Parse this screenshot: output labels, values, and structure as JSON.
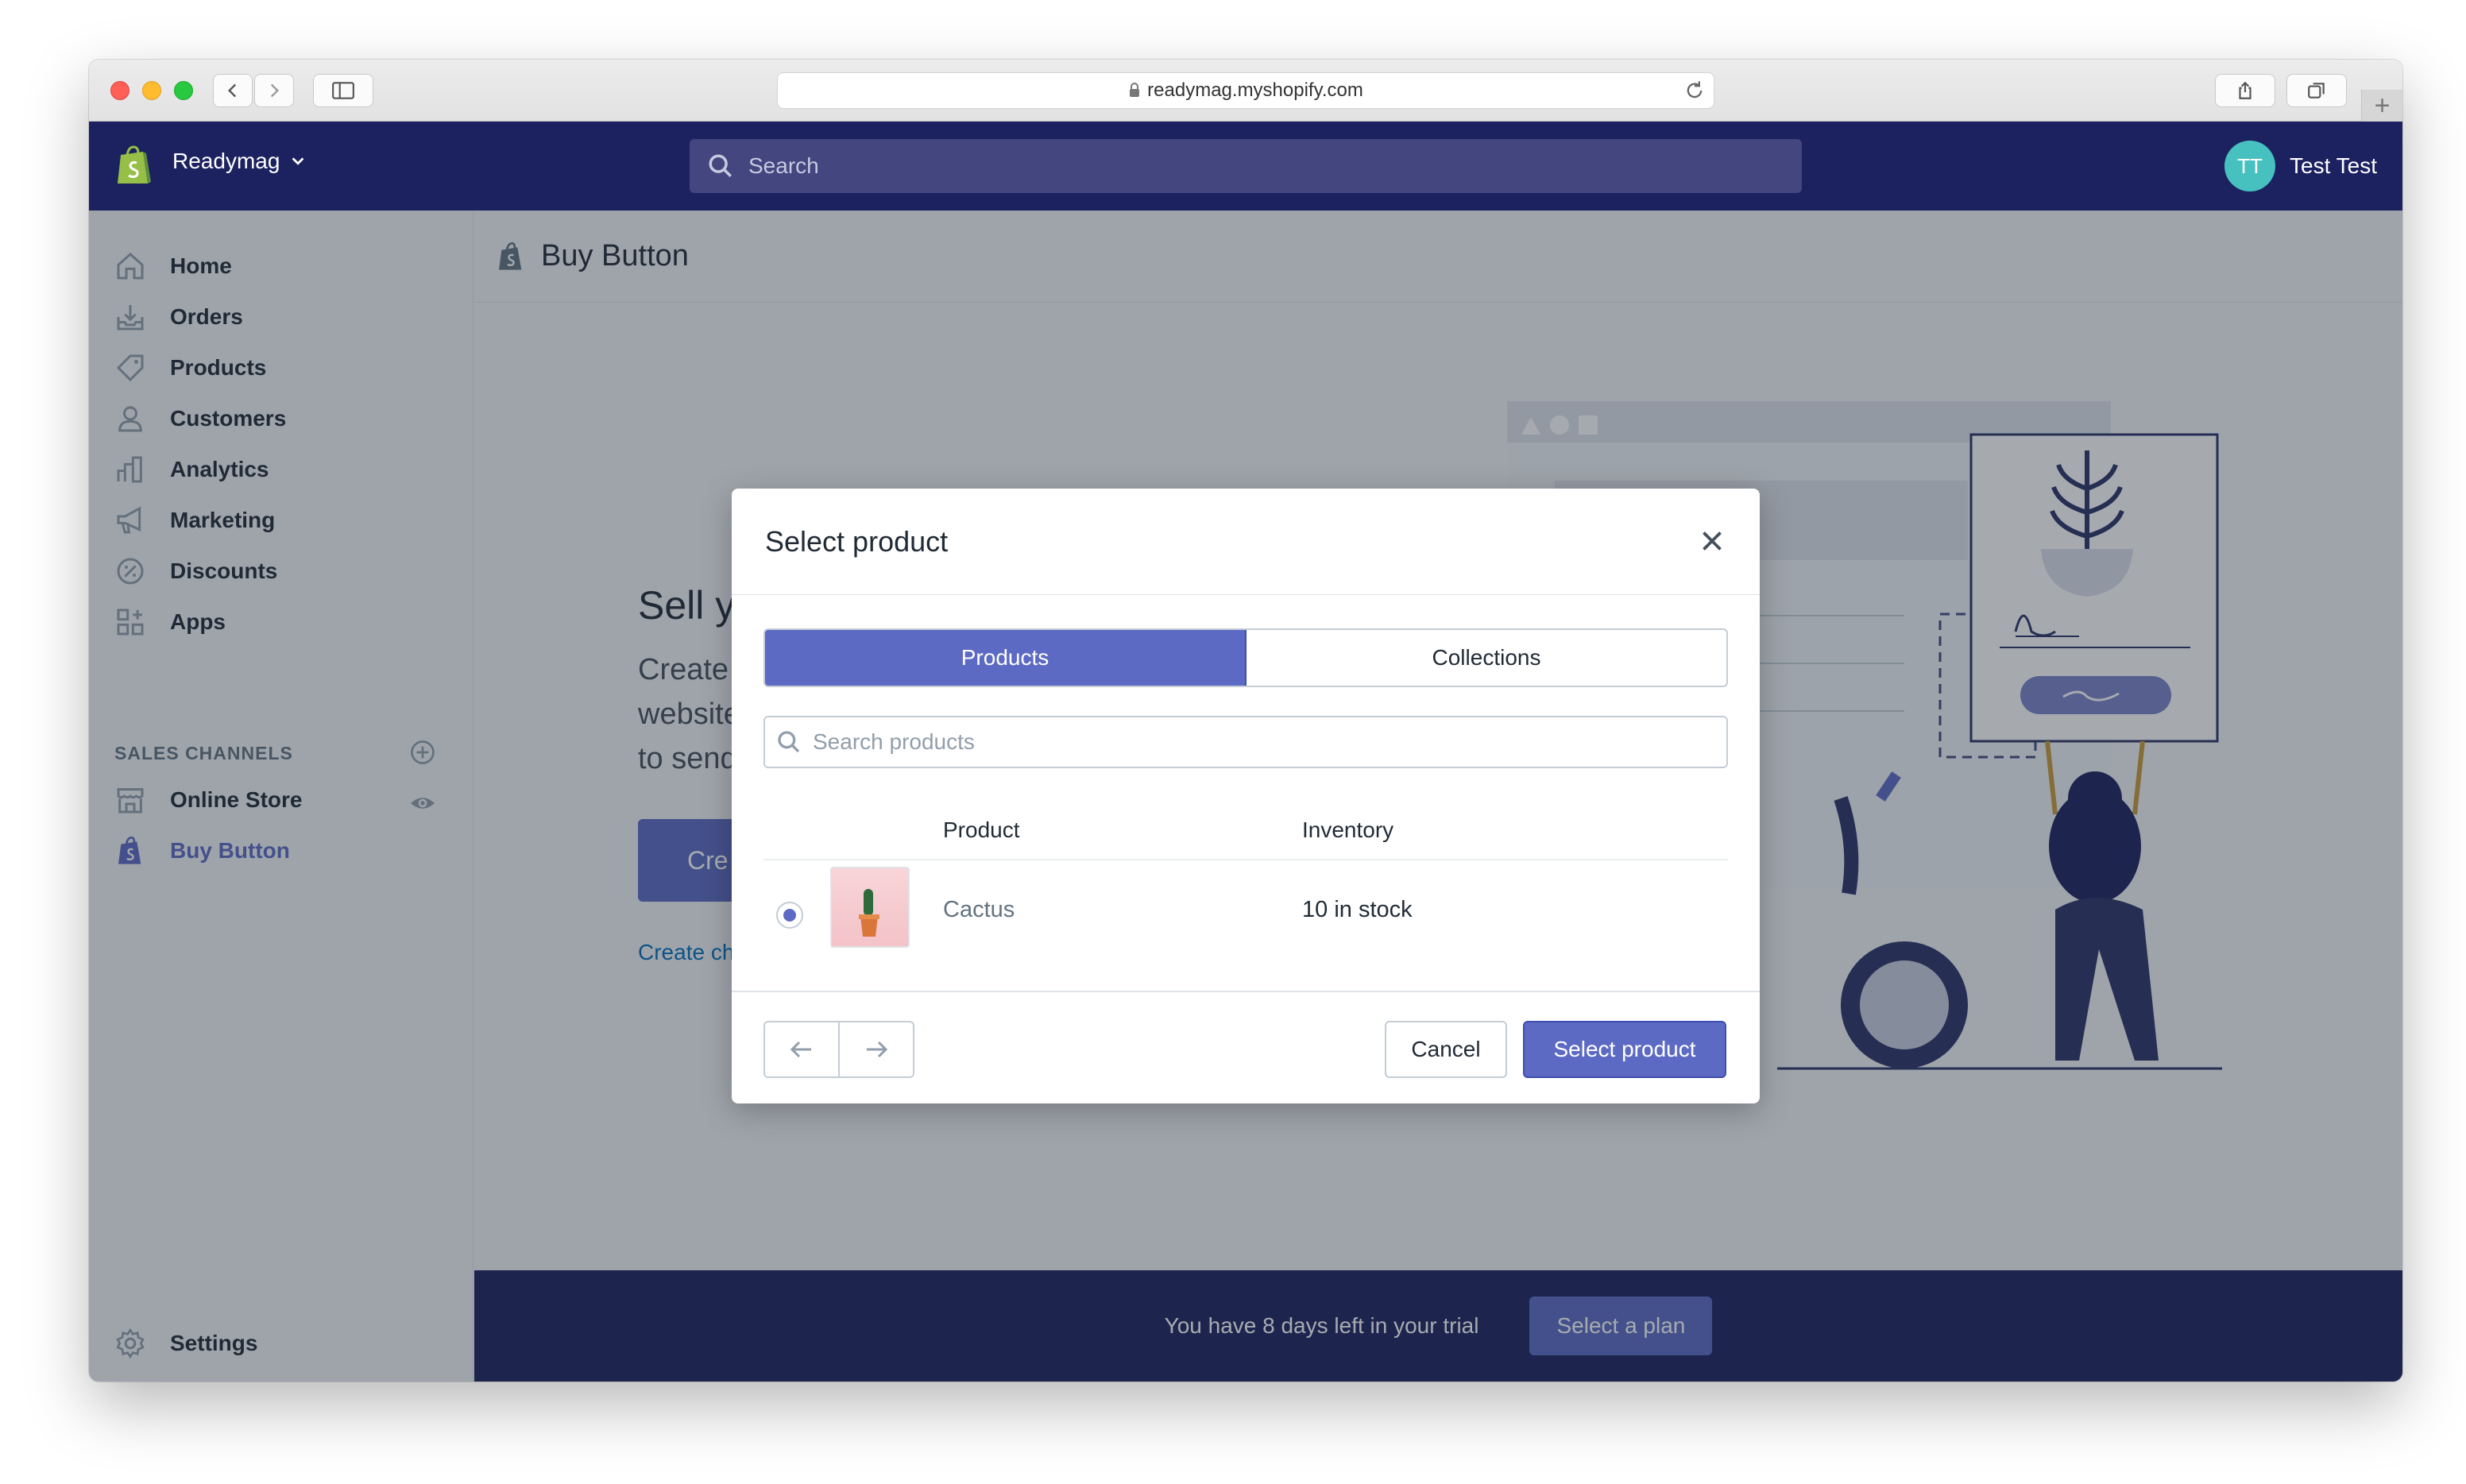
{
  "browser": {
    "url": "readymag.myshopify.com"
  },
  "topbar": {
    "store_name": "Readymag",
    "search_placeholder": "Search",
    "user_initials": "TT",
    "user_name": "Test Test"
  },
  "sidebar": {
    "items": [
      {
        "label": "Home",
        "icon": "home-icon"
      },
      {
        "label": "Orders",
        "icon": "orders-icon"
      },
      {
        "label": "Products",
        "icon": "tag-icon"
      },
      {
        "label": "Customers",
        "icon": "person-icon"
      },
      {
        "label": "Analytics",
        "icon": "bar-chart-icon"
      },
      {
        "label": "Marketing",
        "icon": "megaphone-icon"
      },
      {
        "label": "Discounts",
        "icon": "discount-icon"
      },
      {
        "label": "Apps",
        "icon": "apps-icon"
      }
    ],
    "sales_channels_heading": "SALES CHANNELS",
    "channels": [
      {
        "label": "Online Store",
        "icon": "store-icon"
      },
      {
        "label": "Buy Button",
        "icon": "shopify-bag-icon",
        "active": true
      }
    ],
    "settings_label": "Settings"
  },
  "page": {
    "title": "Buy Button",
    "hero_title": "Sell y",
    "hero_body": "Create website to send",
    "hero_button": "Cre",
    "hero_link": "Create ch"
  },
  "trial": {
    "text": "You have 8 days left in your trial",
    "button": "Select a plan"
  },
  "modal": {
    "title": "Select product",
    "tabs": [
      "Products",
      "Collections"
    ],
    "active_tab": "Products",
    "search_placeholder": "Search products",
    "columns": [
      "Product",
      "Inventory"
    ],
    "rows": [
      {
        "product": "Cactus",
        "inventory": "10 in stock",
        "selected": true
      }
    ],
    "cancel_label": "Cancel",
    "select_label": "Select product"
  },
  "colors": {
    "accent": "#5c6ac4",
    "topbar": "#1c2260",
    "link": "#006fbb"
  }
}
